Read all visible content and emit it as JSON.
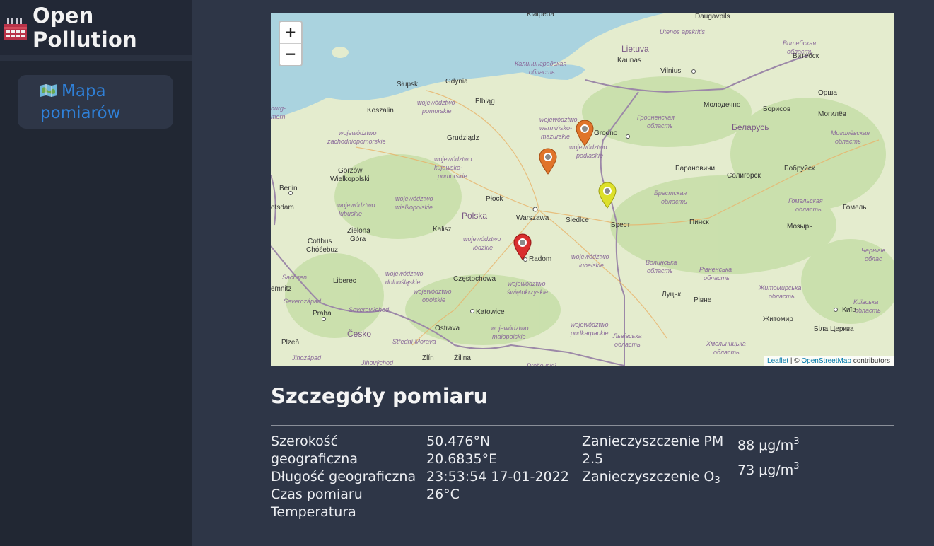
{
  "brand": {
    "title": "Open Pollution",
    "icon": "factory-icon"
  },
  "nav": {
    "items": [
      {
        "label": "Mapa pomiarów",
        "icon": "map-icon"
      }
    ]
  },
  "map": {
    "zoom_in": "+",
    "zoom_out": "−",
    "attribution": {
      "leaflet": "Leaflet",
      "sep": " | © ",
      "osm": "OpenStreetMap",
      "suffix": " contributors"
    },
    "countries": [
      "Polska",
      "Lietuva",
      "Беларусь",
      "Česko"
    ],
    "cities": [
      "Klaipėda",
      "Daugavpils",
      "Kaunas",
      "Vilnius",
      "Słupsk",
      "Gdynia",
      "Koszalin",
      "Elbląg",
      "Grodno",
      "Витебск",
      "Орша",
      "Молодечно",
      "Борисов",
      "Могилёв",
      "Grudziądz",
      "Gorzów Wielkopolski",
      "Berlin",
      "Płock",
      "Warszawa",
      "Siedlce",
      "Брест",
      "Барановичи",
      "Солигорск",
      "Бобруйск",
      "Гомель",
      "Пинск",
      "Мозырь",
      "Kalisz",
      "Zielona Góra",
      "Cottbus Chóśebuz",
      "Radom",
      "Liberec",
      "Częstochowa",
      "Praha",
      "Katowice",
      "Луцьк",
      "Рівне",
      "Житомир",
      "Київ",
      "Біла Церква",
      "Ostrava",
      "Plzeň",
      "Zlín",
      "Žilina",
      "Potsdam",
      "Chemnitz"
    ],
    "regions": [
      "województwo pomorskie",
      "województwo zachodniopomorskie",
      "województwo warmińsko-mazurskie",
      "województwo podlaskie",
      "województwo kujawsko-pomorskie",
      "województwo lubuskie",
      "województwo wielkopolskie",
      "województwo mazowieckie",
      "województwo łódzkie",
      "województwo lubelskie",
      "województwo dolnośląskie",
      "województwo opolskie",
      "województwo świętokrzyskie",
      "województwo śląskie",
      "województwo małopolskie",
      "województwo podkarpackie",
      "Utenos apskritis",
      "Витебская область",
      "Калининградская область",
      "Гродненская область",
      "Минская область",
      "Брестская область",
      "Гомельская область",
      "Могилёвская область",
      "Волинська область",
      "Рівненська область",
      "Житомирська область",
      "Київська область",
      "Львівська область",
      "Хмельницька область",
      "Чернігівська область",
      "Sachsen",
      "Severovýchod",
      "Severozápad",
      "Střední Morava",
      "Jihozápad",
      "Jihovýchod",
      "Prešovský",
      "Mecklenburg-Vorpommern"
    ],
    "markers": [
      {
        "name": "marker-grodno",
        "color": "#e0742a"
      },
      {
        "name": "marker-olsztyn",
        "color": "#e0742a"
      },
      {
        "name": "marker-bialystok",
        "color": "#dde02a"
      },
      {
        "name": "marker-radom",
        "color": "#d92e2e"
      }
    ]
  },
  "details": {
    "title": "Szczegóły pomiaru",
    "labels": {
      "latitude": "Szerokość geograficzna",
      "longitude": "Długość geograficzna",
      "time": "Czas pomiaru",
      "temperature": "Temperatura",
      "pm25": "Zanieczyszczenie PM 2.5",
      "o3_prefix": "Zanieczyszczenie O",
      "o3_sub": "3"
    },
    "values": {
      "latitude": "50.476°N",
      "longitude": "20.6835°E",
      "time": "23:53:54 17-01-2022",
      "temperature": "26°C",
      "pm25_value": "88 μg/m",
      "pm25_sup": "3",
      "o3_value": "73 μg/m",
      "o3_sup": "3"
    }
  }
}
